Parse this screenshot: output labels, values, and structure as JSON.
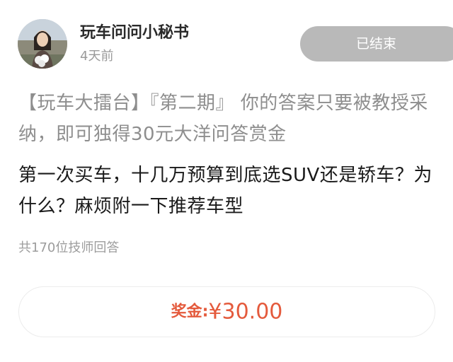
{
  "author": {
    "name": "玩车问问小秘书",
    "time": "4天前"
  },
  "status": {
    "label": "已结束"
  },
  "post": {
    "topic": "【玩车大擂台】『第二期』 你的答案只要被教授采纳，即可独得30元大洋问答赏金",
    "question": "第一次买车，十几万预算到底选SUV还是轿车？为什么？麻烦附一下推荐车型",
    "answer_count": "共170位技师回答"
  },
  "reward": {
    "label": "奖金:",
    "amount": "¥30.00"
  },
  "colors": {
    "accent": "#e45a3c",
    "badge_bg": "#b9b9b9",
    "muted_text": "#9a9a9a"
  }
}
